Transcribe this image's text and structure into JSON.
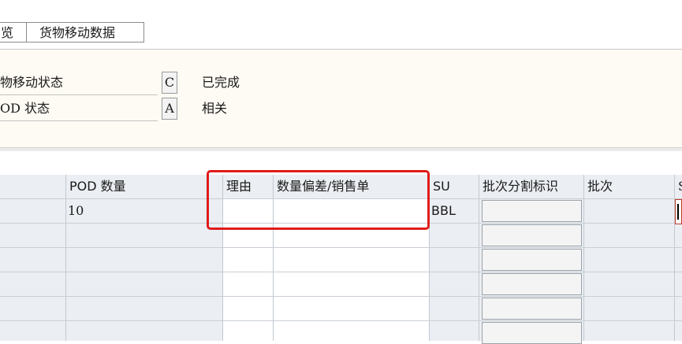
{
  "tabs": [
    {
      "label": "览"
    },
    {
      "label": "货物移动数据"
    }
  ],
  "status": {
    "goods_movement": {
      "label": "物移动状态",
      "code": "C",
      "text": "已完成"
    },
    "pod": {
      "label": "OD 状态",
      "code": "A",
      "text": "相关"
    }
  },
  "table": {
    "columns": [
      "POD 数量",
      "理由",
      "数量偏差/销售单",
      "SU",
      "批次分割标识",
      "批次",
      "S"
    ],
    "rows": [
      {
        "pod_qty": "10",
        "reason": "",
        "deviation": "",
        "su": "BBL",
        "batch_split": "",
        "batch": ""
      }
    ]
  },
  "colors": {
    "highlight": "#e01b1b",
    "table_bg": "#ebeef2",
    "status_bg": "#fefbf4"
  }
}
